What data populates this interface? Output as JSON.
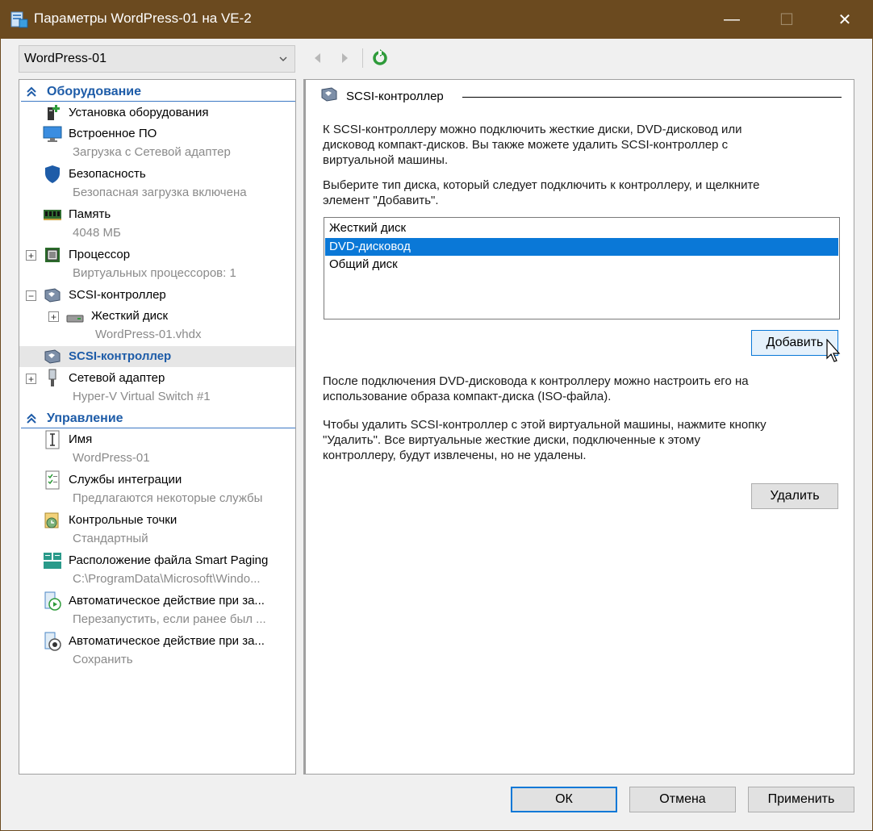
{
  "window": {
    "title": "Параметры WordPress-01 на VE-2",
    "minimize": "—",
    "maximize": "☐",
    "close": "✕"
  },
  "vm_selector": {
    "value": "WordPress-01"
  },
  "tree": {
    "hardware_header": "Оборудование",
    "management_header": "Управление",
    "items": [
      {
        "label": "Установка оборудования",
        "sub": ""
      },
      {
        "label": "Встроенное ПО",
        "sub": "Загрузка с Сетевой адаптер"
      },
      {
        "label": "Безопасность",
        "sub": "Безопасная загрузка включена"
      },
      {
        "label": "Память",
        "sub": "4048 МБ"
      },
      {
        "label": "Процессор",
        "sub": "Виртуальных процессоров: 1"
      },
      {
        "label": "SCSI-контроллер",
        "sub": ""
      },
      {
        "label": "Жесткий диск",
        "sub": "WordPress-01.vhdx"
      },
      {
        "label": "SCSI-контроллер",
        "sub": ""
      },
      {
        "label": "Сетевой адаптер",
        "sub": "Hyper-V Virtual Switch #1"
      }
    ],
    "mgmt_items": [
      {
        "label": "Имя",
        "sub": "WordPress-01"
      },
      {
        "label": "Службы интеграции",
        "sub": "Предлагаются некоторые службы"
      },
      {
        "label": "Контрольные точки",
        "sub": "Стандартный"
      },
      {
        "label": "Расположение файла Smart Paging",
        "sub": "C:\\ProgramData\\Microsoft\\Windo..."
      },
      {
        "label": "Автоматическое действие при за...",
        "sub": "Перезапустить, если ранее был ..."
      },
      {
        "label": "Автоматическое действие при за...",
        "sub": "Сохранить"
      }
    ]
  },
  "detail": {
    "title": "SCSI-контроллер",
    "intro_1": "К SCSI-контроллеру можно подключить жесткие диски, DVD-дисковод или",
    "intro_2": "дисковод компакт-дисков. Вы также можете удалить SCSI-контроллер с",
    "intro_3": "виртуальной машины.",
    "choose_1": "Выберите тип диска, который следует подключить к контроллеру, и щелкните",
    "choose_2": "элемент \"Добавить\".",
    "disk_types": [
      "Жесткий диск",
      "DVD-дисковод",
      "Общий диск"
    ],
    "selected_disk_type": "DVD-дисковод",
    "add_button": "Добавить",
    "after_1": "После подключения DVD-дисковода к контроллеру можно настроить его на",
    "after_2": "использование образа компакт-диска (ISO-файла).",
    "remove_1": "Чтобы удалить SCSI-контроллер с этой виртуальной машины, нажмите кнопку",
    "remove_2": "\"Удалить\". Все виртуальные жесткие диски, подключенные к этому",
    "remove_3": "контроллеру, будут извлечены, но не удалены.",
    "delete_button": "Удалить"
  },
  "footer": {
    "ok": "ОК",
    "cancel": "Отмена",
    "apply": "Применить"
  },
  "colors": {
    "titlebar": "#6b4a1f",
    "section_header": "#1e5ca8",
    "selection": "#0a78d7"
  }
}
